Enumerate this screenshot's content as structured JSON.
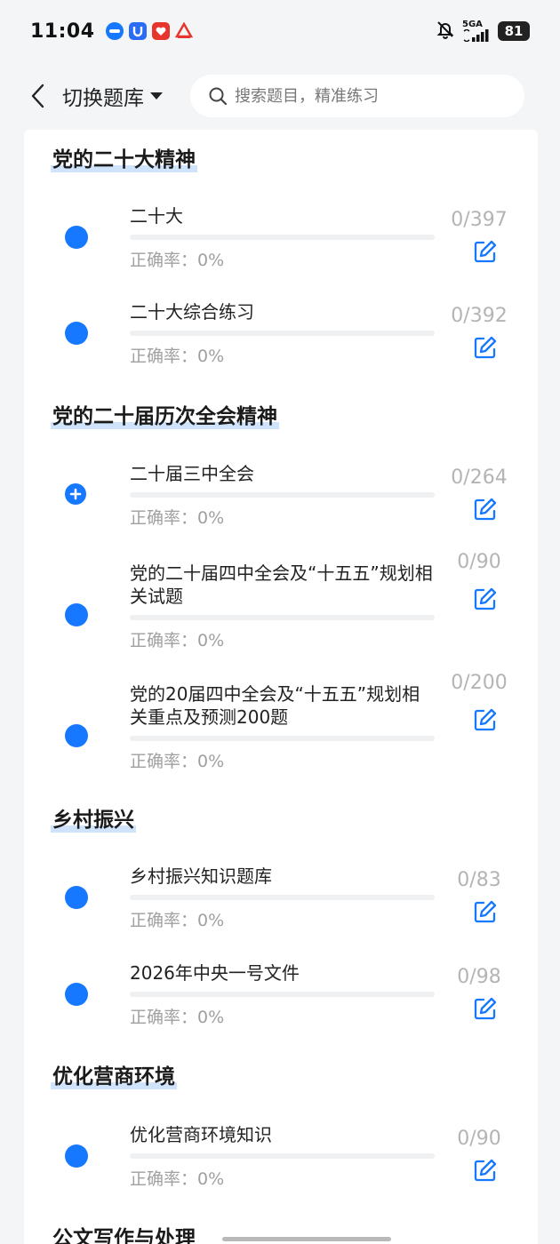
{
  "status_bar": {
    "time": "11:04",
    "network": "5GA",
    "battery": "81",
    "app_icons": [
      "minus-app-icon",
      "u-app-icon",
      "heart-app-icon",
      "triangle-app-icon"
    ]
  },
  "header": {
    "title": "切换题库",
    "search_placeholder": "搜索题目，精准练习"
  },
  "sections": [
    {
      "title": "党的二十大精神",
      "items": [
        {
          "name": "二十大",
          "accuracy": "正确率：0%",
          "count": "0/397"
        },
        {
          "name": "二十大综合练习",
          "accuracy": "正确率：0%",
          "count": "0/392"
        }
      ]
    },
    {
      "title": "党的二十届历次全会精神",
      "items": [
        {
          "name": "二十届三中全会",
          "accuracy": "正确率：0%",
          "count": "0/264"
        },
        {
          "name": "党的二十届四中全会及“十五五”规划相关试题",
          "accuracy": "正确率：0%",
          "count": "0/90"
        },
        {
          "name": "党的20届四中全会及“十五五”规划相关重点及预测200题",
          "accuracy": "正确率：0%",
          "count": "0/200"
        }
      ]
    },
    {
      "title": "乡村振兴",
      "items": [
        {
          "name": "乡村振兴知识题库",
          "accuracy": "正确率：0%",
          "count": "0/83"
        },
        {
          "name": "2026年中央一号文件",
          "accuracy": "正确率：0%",
          "count": "0/98"
        }
      ]
    },
    {
      "title": "优化营商环境",
      "items": [
        {
          "name": "优化营商环境知识",
          "accuracy": "正确率：0%",
          "count": "0/90"
        }
      ]
    },
    {
      "title": "公文写作与处理",
      "items": []
    }
  ],
  "colors": {
    "accent": "#1677ff",
    "highlight": "#cfe3fb",
    "muted": "#a0a0a0"
  }
}
